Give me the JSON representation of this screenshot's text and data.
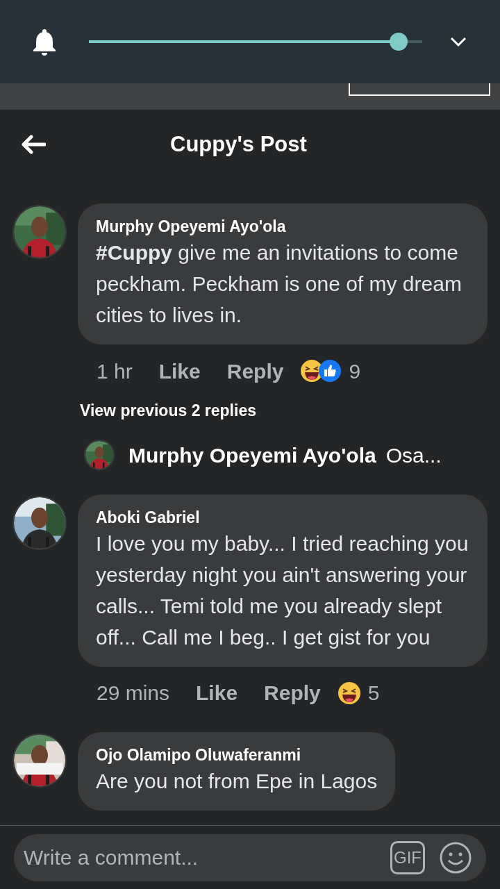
{
  "status_panel": {
    "volume": {
      "level": 0.93
    }
  },
  "header": {
    "title": "Cuppy's Post"
  },
  "comments": [
    {
      "author": "Murphy Opeyemi Ayo'ola",
      "text": "**#Cuppy** give me an invitations to come peckham. Peckham is one of my dream cities to lives in.",
      "time": "1 hr",
      "like": "Like",
      "reply": "Reply",
      "reactions": [
        {
          "kind": "haha"
        },
        {
          "kind": "like"
        }
      ],
      "reaction_count": "9",
      "view_replies": "View previous 2 replies",
      "reply_preview": {
        "author": "Murphy Opeyemi Ayo'ola",
        "text": "Osa..."
      }
    },
    {
      "author": "Aboki Gabriel",
      "text": "I love you my baby... I tried reaching you yesterday night you ain't answering your calls... Temi told me you already slept off... Call me I beg.. I get gist for you",
      "time": "29 mins",
      "like": "Like",
      "reply": "Reply",
      "reactions": [
        {
          "kind": "haha"
        }
      ],
      "reaction_count": "5"
    },
    {
      "author": "Ojo Olamipo Oluwaferanmi",
      "text": "Are you not from Epe in Lagos"
    }
  ],
  "composer": {
    "placeholder": "Write a comment...",
    "gif": "GIF"
  }
}
